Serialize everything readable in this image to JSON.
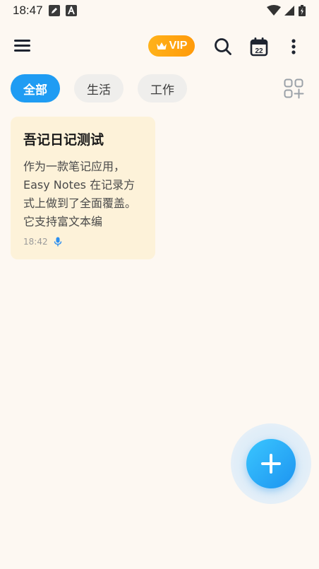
{
  "status_bar": {
    "time": "18:47"
  },
  "app_bar": {
    "vip_label": "VIP",
    "calendar_day": "22"
  },
  "tabs": [
    {
      "label": "全部",
      "active": true
    },
    {
      "label": "生活",
      "active": false
    },
    {
      "label": "工作",
      "active": false
    }
  ],
  "notes": [
    {
      "title": "吾记日记测试",
      "preview": "作为一款笔记应用，Easy Notes 在记录方式上做到了全面覆盖。它支持富文本编",
      "time": "18:42"
    }
  ],
  "colors": {
    "accent": "#1f9cf3",
    "vip": "#ffa512",
    "card": "#fdf2d9",
    "background": "#fdf8f2"
  }
}
